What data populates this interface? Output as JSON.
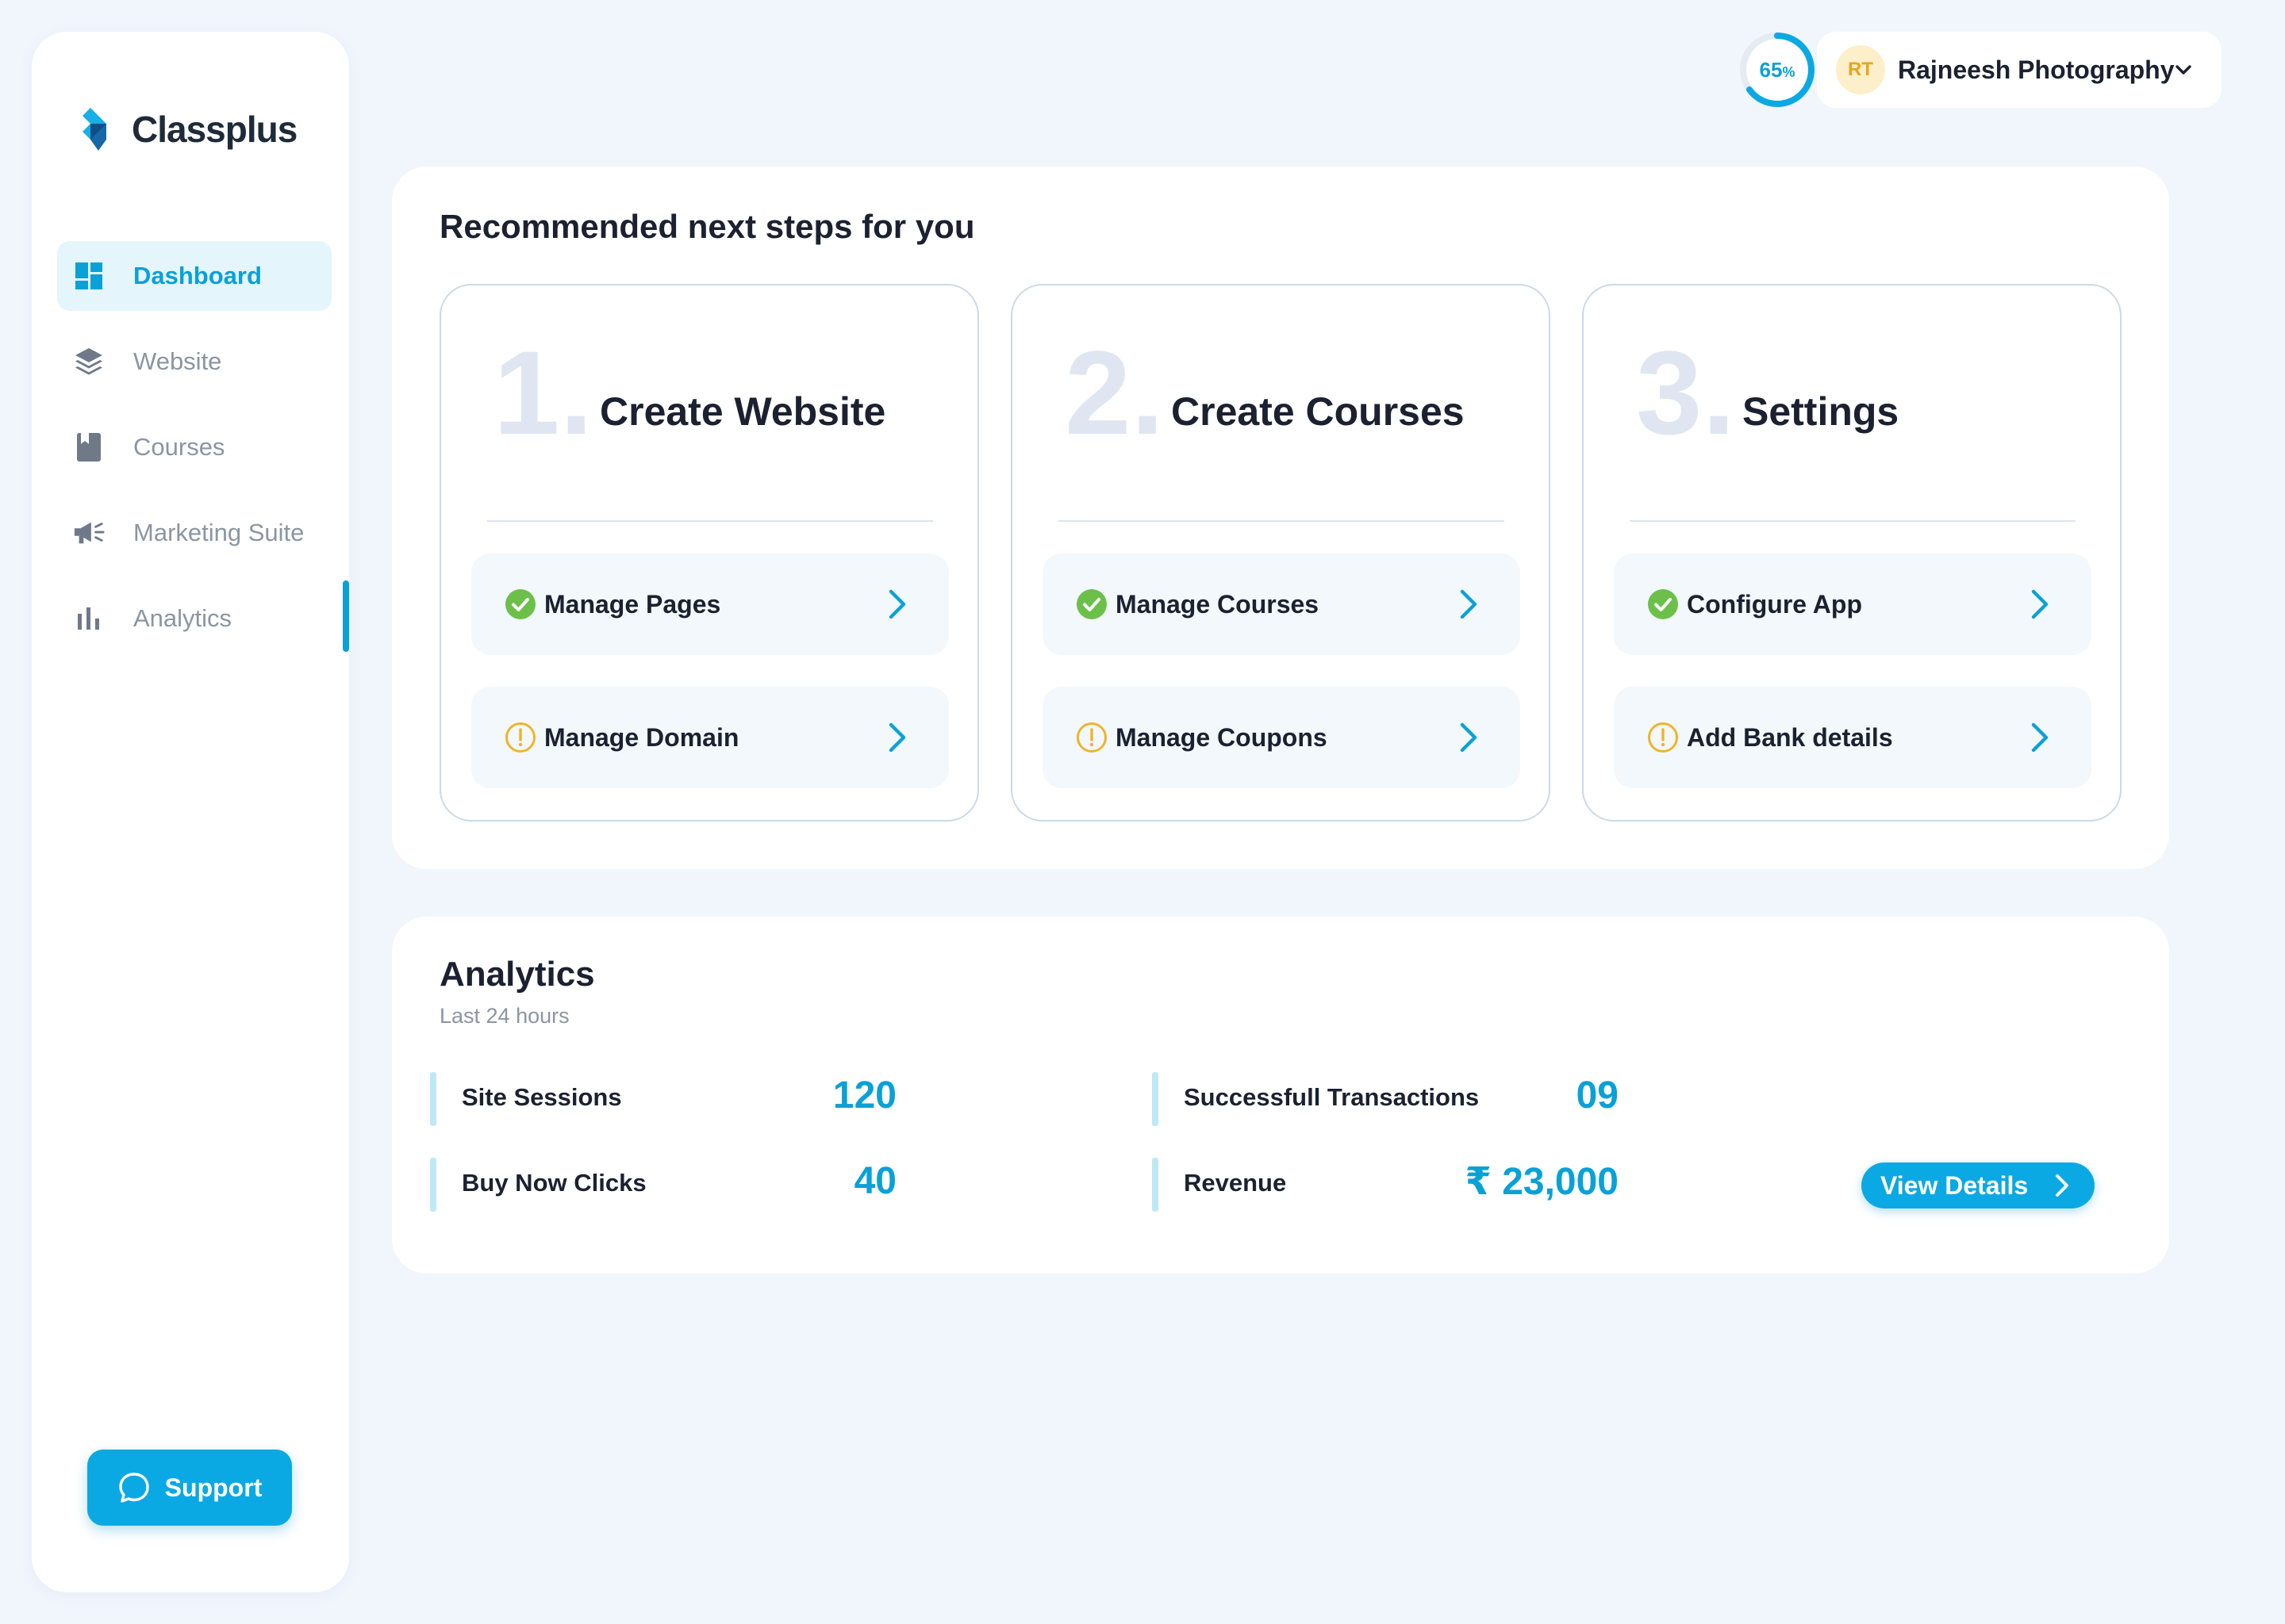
{
  "brand": {
    "name": "Classplus"
  },
  "sidebar": {
    "items": [
      {
        "label": "Dashboard",
        "icon": "dashboard-icon",
        "active": true
      },
      {
        "label": "Website",
        "icon": "layers-icon",
        "active": false
      },
      {
        "label": "Courses",
        "icon": "book-icon",
        "active": false
      },
      {
        "label": "Marketing Suite",
        "icon": "megaphone-icon",
        "active": false
      },
      {
        "label": "Analytics",
        "icon": "bar-chart-icon",
        "active": false
      }
    ],
    "support_label": "Support"
  },
  "header": {
    "progress_value": "65",
    "progress_unit": "%",
    "progress_fraction": 0.65,
    "avatar_initials": "RT",
    "account_name": "Rajneesh Photography"
  },
  "recommended": {
    "title": "Recommended next steps for you",
    "steps": [
      {
        "number": "1.",
        "title": "Create Website",
        "items": [
          {
            "label": "Manage Pages",
            "status": "done"
          },
          {
            "label": "Manage Domain",
            "status": "pending"
          }
        ]
      },
      {
        "number": "2.",
        "title": "Create Courses",
        "items": [
          {
            "label": "Manage Courses",
            "status": "done"
          },
          {
            "label": "Manage Coupons",
            "status": "pending"
          }
        ]
      },
      {
        "number": "3.",
        "title": "Settings",
        "items": [
          {
            "label": "Configure App",
            "status": "done"
          },
          {
            "label": "Add Bank details",
            "status": "pending"
          }
        ]
      }
    ]
  },
  "analytics": {
    "title": "Analytics",
    "subtitle": "Last 24 hours",
    "metrics": [
      {
        "label": "Site Sessions",
        "value": "120"
      },
      {
        "label": "Successfull Transactions",
        "value": "09"
      },
      {
        "label": "Buy Now Clicks",
        "value": "40"
      },
      {
        "label": "Revenue",
        "value": "₹ 23,000"
      }
    ],
    "view_details_label": "View Details"
  },
  "colors": {
    "accent": "#0aa9e3",
    "done": "#6cc04a",
    "pending": "#f0b429",
    "background": "#f1f6fd"
  }
}
